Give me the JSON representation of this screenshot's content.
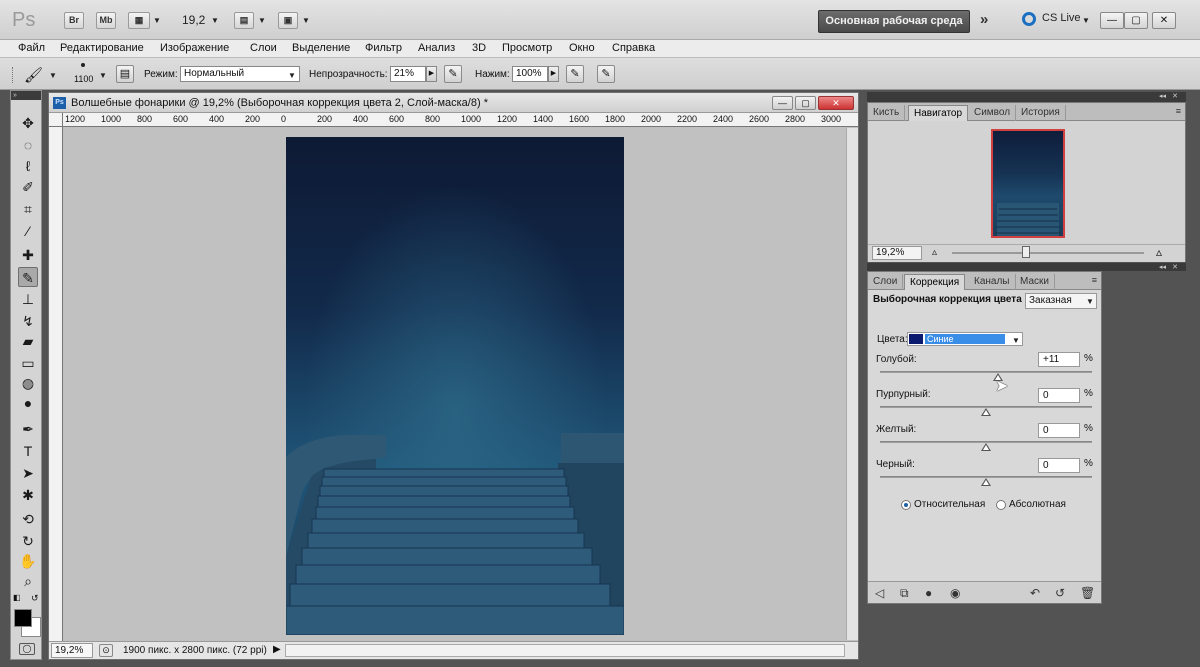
{
  "app": {
    "logo": "Ps",
    "buttons": {
      "bridge": "Br",
      "minibridge": "Mb"
    },
    "zoom": "19,2",
    "workspace": "Основная рабочая среда",
    "workspace_more": "»",
    "cs_live": "CS Live"
  },
  "menu": [
    "Файл",
    "Редактирование",
    "Изображение",
    "Слои",
    "Выделение",
    "Фильтр",
    "Анализ",
    "3D",
    "Просмотр",
    "Окно",
    "Справка"
  ],
  "options": {
    "brush_size": "1100",
    "mode_label": "Режим:",
    "mode_value": "Нормальный",
    "opacity_label": "Непрозрачность:",
    "opacity_value": "21%",
    "flow_label": "Нажим:",
    "flow_value": "100%"
  },
  "document": {
    "title": "Волшебные фонарики @ 19,2% (Выборочная коррекция цвета 2, Слой-маска/8) *",
    "ruler_h": [
      "1200",
      "1000",
      "800",
      "600",
      "400",
      "200",
      "0",
      "200",
      "400",
      "600",
      "800",
      "1000",
      "1200",
      "1400",
      "1600",
      "1800",
      "2000",
      "2200",
      "2400",
      "2600",
      "2800",
      "3000"
    ],
    "status_zoom": "19,2%",
    "status_info": "1900 пикс. x 2800 пикс. (72 ppi)"
  },
  "navigator_panel": {
    "tabs": [
      "Кисть",
      "Навигатор",
      "Символ",
      "История"
    ],
    "active_tab": "Навигатор",
    "zoom": "19,2%"
  },
  "adjust_panel": {
    "tabs": [
      "Слои",
      "Коррекция",
      "Каналы",
      "Маски"
    ],
    "active_tab": "Коррекция",
    "title": "Выборочная коррекция цвета",
    "preset": "Заказная",
    "colors_label": "Цвета:",
    "colors_value": "Синие",
    "sliders": [
      {
        "label": "Голубой:",
        "value": "+11",
        "unit": "%",
        "level": 0.555
      },
      {
        "label": "Пурпурный:",
        "value": "0",
        "unit": "%",
        "level": 0.5
      },
      {
        "label": "Желтый:",
        "value": "0",
        "unit": "%",
        "level": 0.5
      },
      {
        "label": "Черный:",
        "value": "0",
        "unit": "%",
        "level": 0.5
      }
    ],
    "method_relative": "Относительная",
    "method_absolute": "Абсолютная",
    "method_selected": "relative"
  },
  "colors": {
    "accent": "#1d5fa8",
    "swatch_blue": "#0a1a6e",
    "foreground": "#000000",
    "background": "#ffffff"
  }
}
